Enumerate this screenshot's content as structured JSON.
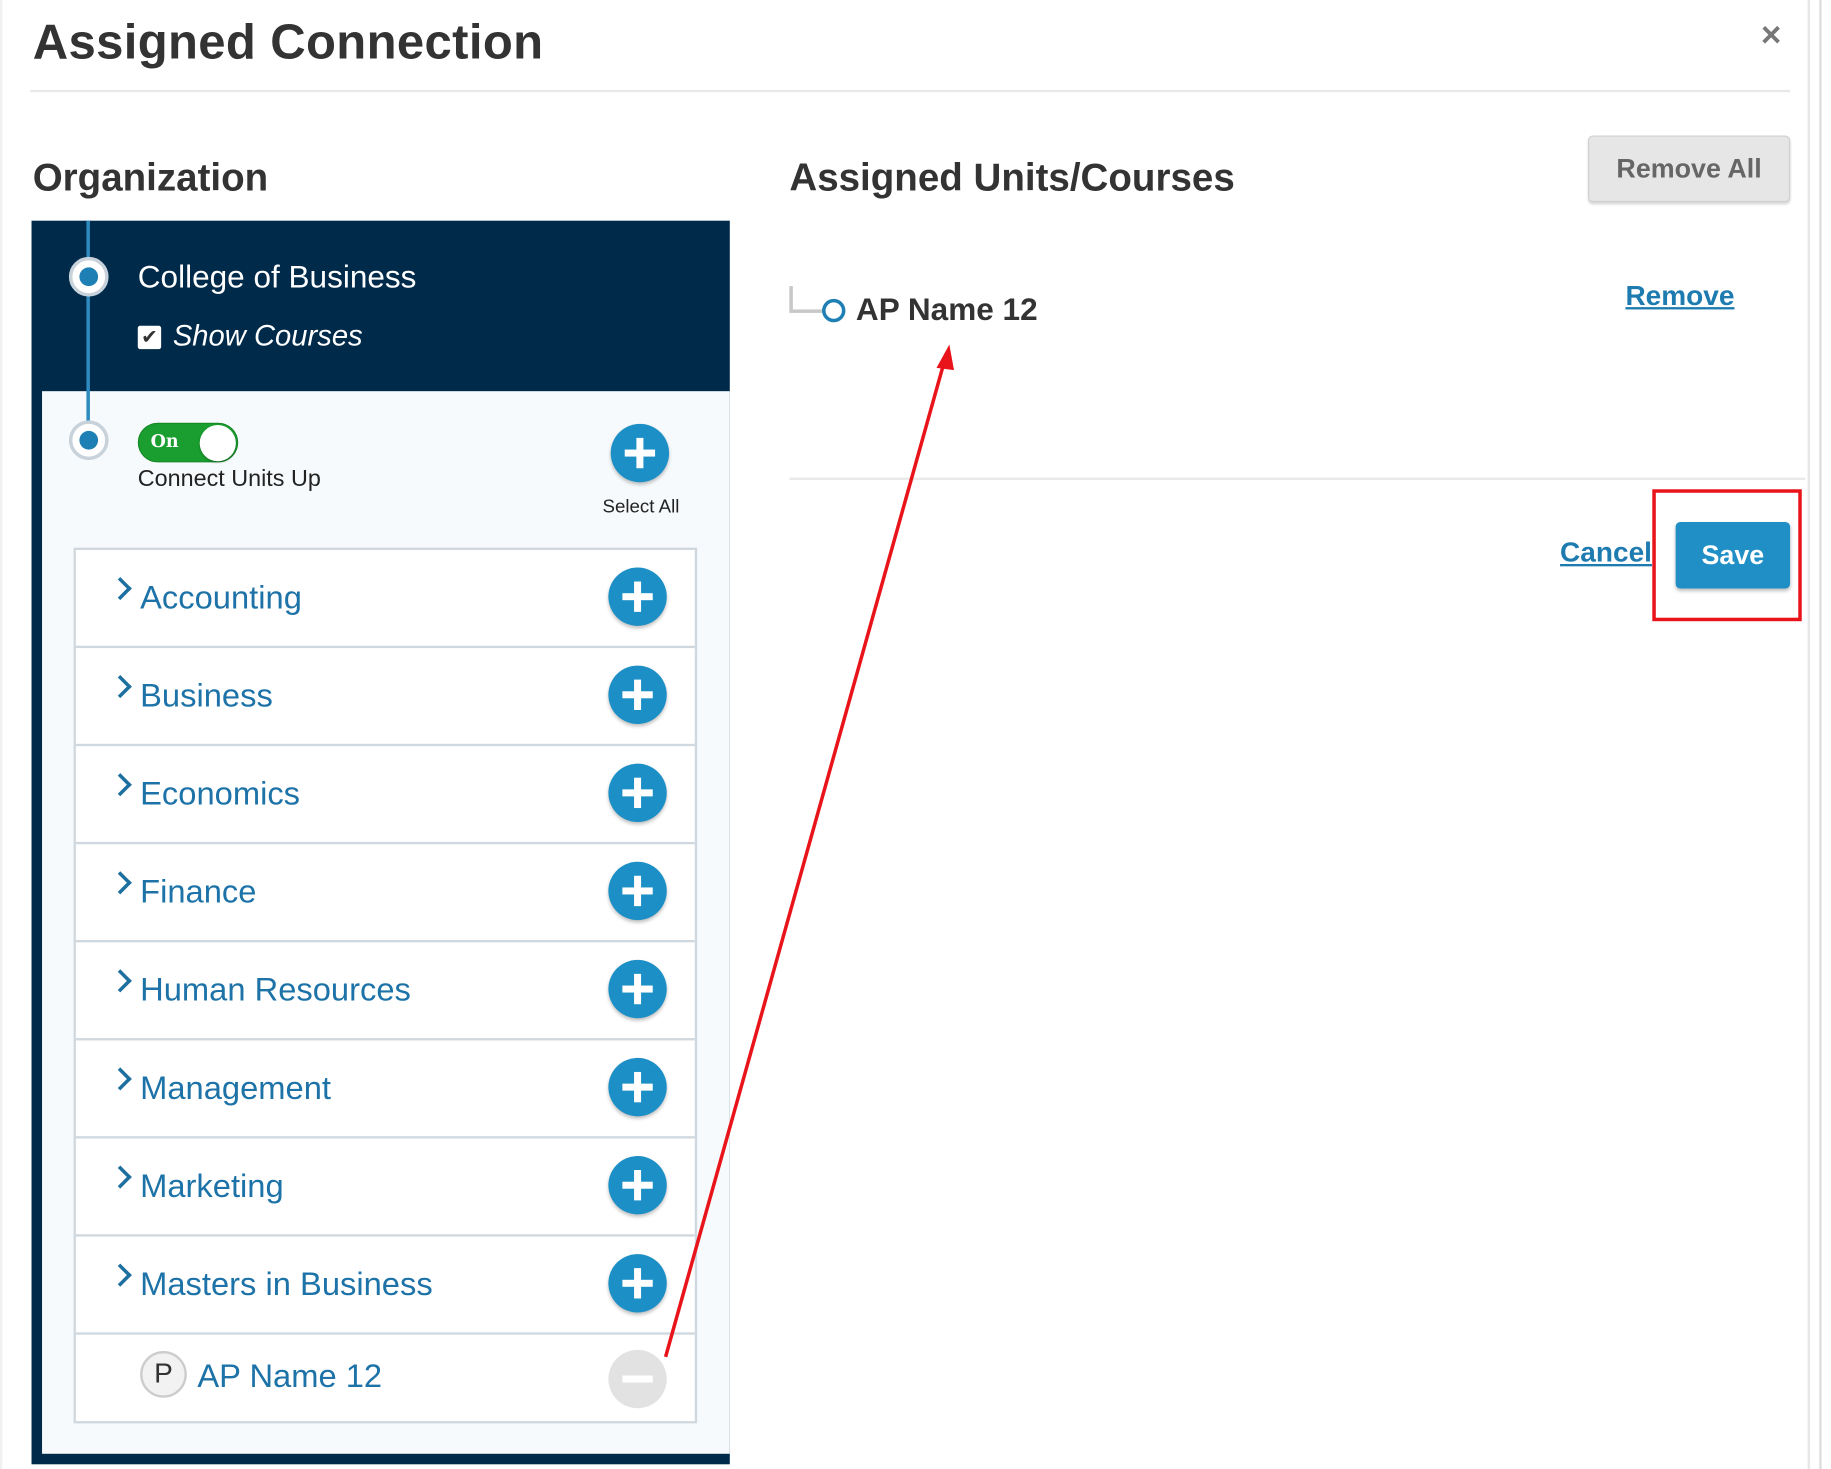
{
  "dialog": {
    "title": "Assigned Connection",
    "close_icon": "close-icon",
    "close_glyph": "×"
  },
  "organization": {
    "heading": "Organization",
    "college_name": "College of Business",
    "show_courses_label": "Show Courses",
    "show_courses_checked": true,
    "checkbox_glyph": "✔",
    "toggle": {
      "state_label": "On",
      "is_on": true,
      "label": "Connect Units Up"
    },
    "select_all_label": "Select All",
    "units": [
      {
        "label": "Accounting"
      },
      {
        "label": "Business"
      },
      {
        "label": "Economics"
      },
      {
        "label": "Finance"
      },
      {
        "label": "Human Resources"
      },
      {
        "label": "Management"
      },
      {
        "label": "Marketing"
      },
      {
        "label": "Masters in Business"
      }
    ],
    "assigned_child": {
      "badge": "P",
      "label": "AP Name 12"
    }
  },
  "assigned": {
    "heading": "Assigned Units/Courses",
    "remove_all_label": "Remove All",
    "items": [
      {
        "name": "AP Name 12",
        "remove_label": "Remove"
      }
    ]
  },
  "actions": {
    "cancel_label": "Cancel",
    "save_label": "Save"
  },
  "colors": {
    "navy_panel": "#002a4a",
    "accent_blue": "#1b8fc6",
    "link_blue": "#1d73a8",
    "toggle_green": "#1a9e2f",
    "annotation_red": "#e8141a"
  }
}
